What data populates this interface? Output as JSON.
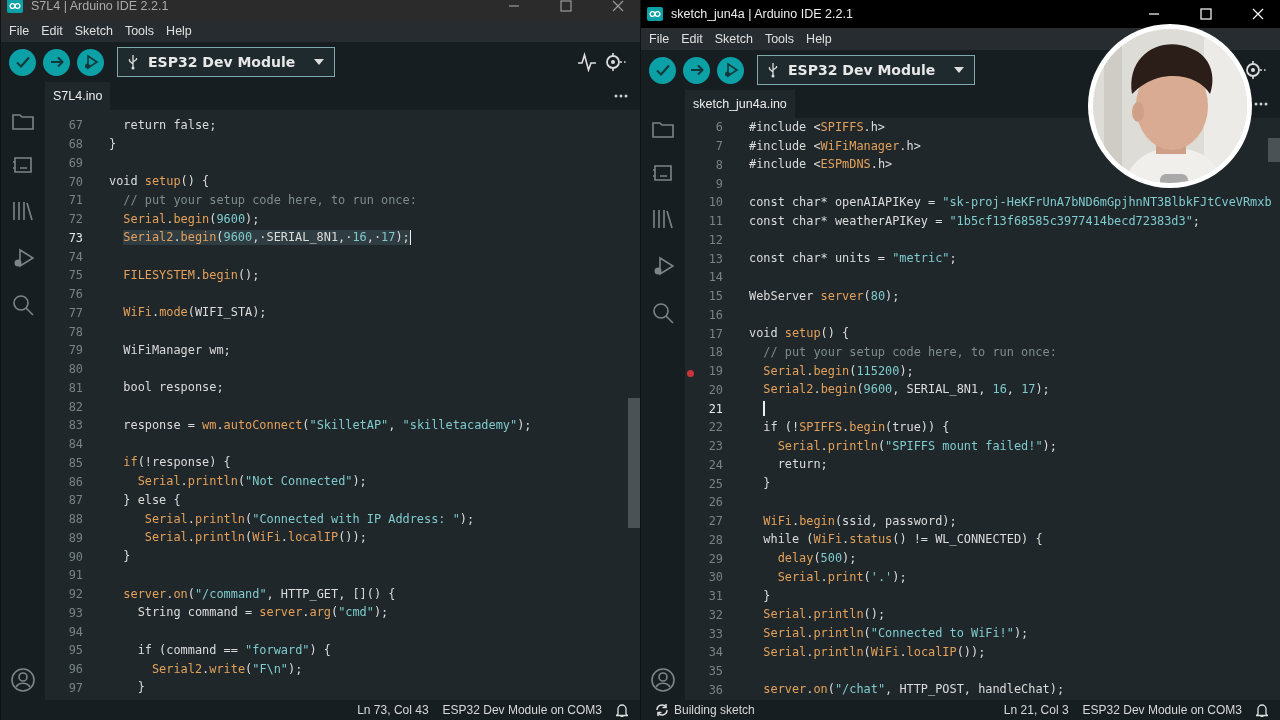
{
  "windows": [
    {
      "title": "S7L4 | Arduino IDE 2.2.1",
      "active": false,
      "menu": [
        "File",
        "Edit",
        "Sketch",
        "Tools",
        "Help"
      ],
      "board": "ESP32 Dev Module",
      "tab": "S7L4.ino",
      "lines": [
        {
          "number": "67",
          "code": "  return false;",
          "current": false,
          "selected": false,
          "breakpoint": false
        },
        {
          "number": "68",
          "code": "}",
          "current": false,
          "selected": false,
          "breakpoint": false
        },
        {
          "number": "69",
          "current": false,
          "selected": false,
          "breakpoint": false
        },
        {
          "number": "70",
          "code": "void setup() {",
          "current": false,
          "selected": false,
          "breakpoint": false
        },
        {
          "number": "71",
          "code": "  // put your setup code here, to run once:",
          "current": false,
          "selected": false,
          "breakpoint": false
        },
        {
          "number": "72",
          "code": "  Serial.begin(9600);",
          "current": false,
          "selected": false,
          "breakpoint": false
        },
        {
          "number": "73",
          "code": "  Serial2.begin(9600,·SERIAL_8N1,·16,·17);",
          "current": true,
          "selected": true,
          "breakpoint": false
        },
        {
          "number": "74",
          "current": false,
          "selected": false,
          "breakpoint": false
        },
        {
          "number": "75",
          "code": "  FILESYSTEM.begin();",
          "current": false,
          "selected": false,
          "breakpoint": false
        },
        {
          "number": "76",
          "current": false,
          "selected": false,
          "breakpoint": false
        },
        {
          "number": "77",
          "code": "  WiFi.mode(WIFI_STA);",
          "current": false,
          "selected": false,
          "breakpoint": false
        },
        {
          "number": "78",
          "current": false,
          "selected": false,
          "breakpoint": false
        },
        {
          "number": "79",
          "code": "  WiFiManager wm;",
          "current": false,
          "selected": false,
          "breakpoint": false
        },
        {
          "number": "80",
          "current": false,
          "selected": false,
          "breakpoint": false
        },
        {
          "number": "81",
          "code": "  bool response;",
          "current": false,
          "selected": false,
          "breakpoint": false
        },
        {
          "number": "82",
          "current": false,
          "selected": false,
          "breakpoint": false
        },
        {
          "number": "83",
          "code": "  response = wm.autoConnect(\"SkilletAP\", \"skilletacademy\");",
          "current": false,
          "selected": false,
          "breakpoint": false
        },
        {
          "number": "84",
          "current": false,
          "selected": false,
          "breakpoint": false
        },
        {
          "number": "85",
          "code": "  if(!response) {",
          "current": false,
          "selected": false,
          "breakpoint": false
        },
        {
          "number": "86",
          "code": "    Serial.println(\"Not Connected\");",
          "current": false,
          "selected": false,
          "breakpoint": false
        },
        {
          "number": "87",
          "code": "  } else {",
          "current": false,
          "selected": false,
          "breakpoint": false
        },
        {
          "number": "88",
          "code": "     Serial.println(\"Connected with IP Address: \");",
          "current": false,
          "selected": false,
          "breakpoint": false
        },
        {
          "number": "89",
          "code": "     Serial.println(WiFi.localIP());",
          "current": false,
          "selected": false,
          "breakpoint": false
        },
        {
          "number": "90",
          "code": "  }",
          "current": false,
          "selected": false,
          "breakpoint": false
        },
        {
          "number": "91",
          "current": false,
          "selected": false,
          "breakpoint": false
        },
        {
          "number": "92",
          "code": "  server.on(\"/command\", HTTP_GET, []() {",
          "current": false,
          "selected": false,
          "breakpoint": false
        },
        {
          "number": "93",
          "code": "    String command = server.arg(\"cmd\");",
          "current": false,
          "selected": false,
          "breakpoint": false
        },
        {
          "number": "94",
          "current": false,
          "selected": false,
          "breakpoint": false
        },
        {
          "number": "95",
          "code": "    if (command == \"forward\") {",
          "current": false,
          "selected": false,
          "breakpoint": false
        },
        {
          "number": "96",
          "code": "      Serial2.write(\"F\\n\");",
          "current": false,
          "selected": false,
          "breakpoint": false
        },
        {
          "number": "97",
          "code": "    }",
          "current": false,
          "selected": false,
          "breakpoint": false
        }
      ],
      "status": {
        "position": "Ln 73, Col 43",
        "board": "ESP32 Dev Module on COM3"
      }
    },
    {
      "title": "sketch_jun4a | Arduino IDE 2.2.1",
      "active": true,
      "menu": [
        "File",
        "Edit",
        "Sketch",
        "Tools",
        "Help"
      ],
      "board": "ESP32 Dev Module",
      "tab": "sketch_jun4a.ino",
      "lines": [
        {
          "number": "6",
          "code": "#include <SPIFFS.h>",
          "current": false,
          "selected": false,
          "breakpoint": false
        },
        {
          "number": "7",
          "code": "#include <WiFiManager.h>",
          "current": false,
          "selected": false,
          "breakpoint": false
        },
        {
          "number": "8",
          "code": "#include <ESPmDNS.h>",
          "current": false,
          "selected": false,
          "breakpoint": false
        },
        {
          "number": "9",
          "current": false,
          "selected": false,
          "breakpoint": false
        },
        {
          "number": "10",
          "code": "const char* openAIAPIKey = \"sk-proj-HeKFrUnA7bND6mGpjhnNT3BlbkFJtCveVRmxb",
          "current": false,
          "selected": false,
          "breakpoint": false
        },
        {
          "number": "11",
          "code": "const char* weatherAPIKey = \"1b5cf13f68585c3977414becd72383d3\";",
          "current": false,
          "selected": false,
          "breakpoint": false
        },
        {
          "number": "12",
          "current": false,
          "selected": false,
          "breakpoint": false
        },
        {
          "number": "13",
          "code": "const char* units = \"metric\";",
          "current": false,
          "selected": false,
          "breakpoint": false
        },
        {
          "number": "14",
          "current": false,
          "selected": false,
          "breakpoint": false
        },
        {
          "number": "15",
          "code": "WebServer server(80);",
          "current": false,
          "selected": false,
          "breakpoint": false
        },
        {
          "number": "16",
          "current": false,
          "selected": false,
          "breakpoint": false
        },
        {
          "number": "17",
          "code": "void setup() {",
          "current": false,
          "selected": false,
          "breakpoint": false
        },
        {
          "number": "18",
          "code": "  // put your setup code here, to run once:",
          "current": false,
          "selected": false,
          "breakpoint": false
        },
        {
          "number": "19",
          "code": "  Serial.begin(115200);",
          "current": false,
          "selected": false,
          "breakpoint": true
        },
        {
          "number": "20",
          "code": "  Serial2.begin(9600, SERIAL_8N1, 16, 17);",
          "current": false,
          "selected": false,
          "breakpoint": false
        },
        {
          "number": "21",
          "current": true,
          "selected": false,
          "breakpoint": false
        },
        {
          "number": "22",
          "code": "  if (!SPIFFS.begin(true)) {",
          "current": false,
          "selected": false,
          "breakpoint": false
        },
        {
          "number": "23",
          "code": "    Serial.println(\"SPIFFS mount failed!\");",
          "current": false,
          "selected": false,
          "breakpoint": false
        },
        {
          "number": "24",
          "code": "    return;",
          "current": false,
          "selected": false,
          "breakpoint": false
        },
        {
          "number": "25",
          "code": "  }",
          "current": false,
          "selected": false,
          "breakpoint": false
        },
        {
          "number": "26",
          "current": false,
          "selected": false,
          "breakpoint": false
        },
        {
          "number": "27",
          "code": "  WiFi.begin(ssid, password);",
          "current": false,
          "selected": false,
          "breakpoint": false
        },
        {
          "number": "28",
          "code": "  while (WiFi.status() != WL_CONNECTED) {",
          "current": false,
          "selected": false,
          "breakpoint": false
        },
        {
          "number": "29",
          "code": "    delay(500);",
          "current": false,
          "selected": false,
          "breakpoint": false
        },
        {
          "number": "30",
          "code": "    Serial.print('.');",
          "current": false,
          "selected": false,
          "breakpoint": false
        },
        {
          "number": "31",
          "code": "  }",
          "current": false,
          "selected": false,
          "breakpoint": false
        },
        {
          "number": "32",
          "code": "  Serial.println();",
          "current": false,
          "selected": false,
          "breakpoint": false
        },
        {
          "number": "33",
          "code": "  Serial.println(\"Connected to WiFi!\");",
          "current": false,
          "selected": false,
          "breakpoint": false
        },
        {
          "number": "34",
          "code": "  Serial.println(WiFi.localIP());",
          "current": false,
          "selected": false,
          "breakpoint": false
        },
        {
          "number": "35",
          "current": false,
          "selected": false,
          "breakpoint": false
        },
        {
          "number": "36",
          "code": "  server.on(\"/chat\", HTTP_POST, handleChat);",
          "current": false,
          "selected": false,
          "breakpoint": false
        }
      ],
      "status": {
        "activity": "Building sketch",
        "position": "Ln 21, Col 3",
        "board": "ESP32 Dev Module on COM3"
      }
    }
  ]
}
